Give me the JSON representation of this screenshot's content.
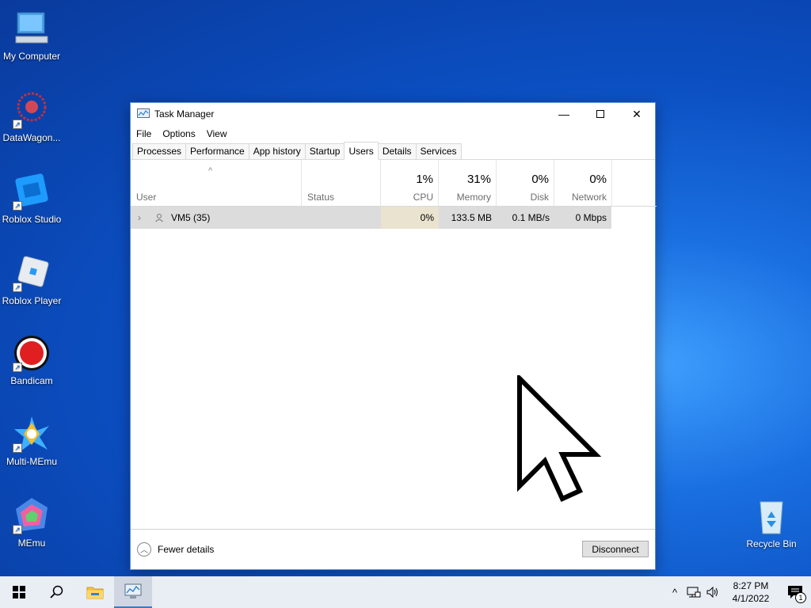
{
  "desktop": {
    "icons": [
      {
        "label": "My Computer"
      },
      {
        "label": "DataWagon..."
      },
      {
        "label": "Roblox Studio"
      },
      {
        "label": "Roblox Player"
      },
      {
        "label": "Bandicam"
      },
      {
        "label": "Multi-MEmu"
      },
      {
        "label": "MEmu"
      },
      {
        "label": "Recycle Bin"
      }
    ]
  },
  "window": {
    "title": "Task Manager",
    "menu": [
      "File",
      "Options",
      "View"
    ],
    "tabs": [
      "Processes",
      "Performance",
      "App history",
      "Startup",
      "Users",
      "Details",
      "Services"
    ],
    "active_tab": "Users",
    "columns": {
      "user": {
        "label": "User"
      },
      "status": {
        "label": "Status"
      },
      "cpu": {
        "label": "CPU",
        "pct": "1%"
      },
      "memory": {
        "label": "Memory",
        "pct": "31%"
      },
      "disk": {
        "label": "Disk",
        "pct": "0%"
      },
      "network": {
        "label": "Network",
        "pct": "0%"
      }
    },
    "rows": [
      {
        "user": "VM5 (35)",
        "status": "",
        "cpu": "0%",
        "memory": "133.5 MB",
        "disk": "0.1 MB/s",
        "network": "0 Mbps"
      }
    ],
    "footer": {
      "fewer_details": "Fewer details",
      "disconnect": "Disconnect"
    }
  },
  "taskbar": {
    "time": "8:27 PM",
    "date": "4/1/2022",
    "notification_count": "1"
  }
}
